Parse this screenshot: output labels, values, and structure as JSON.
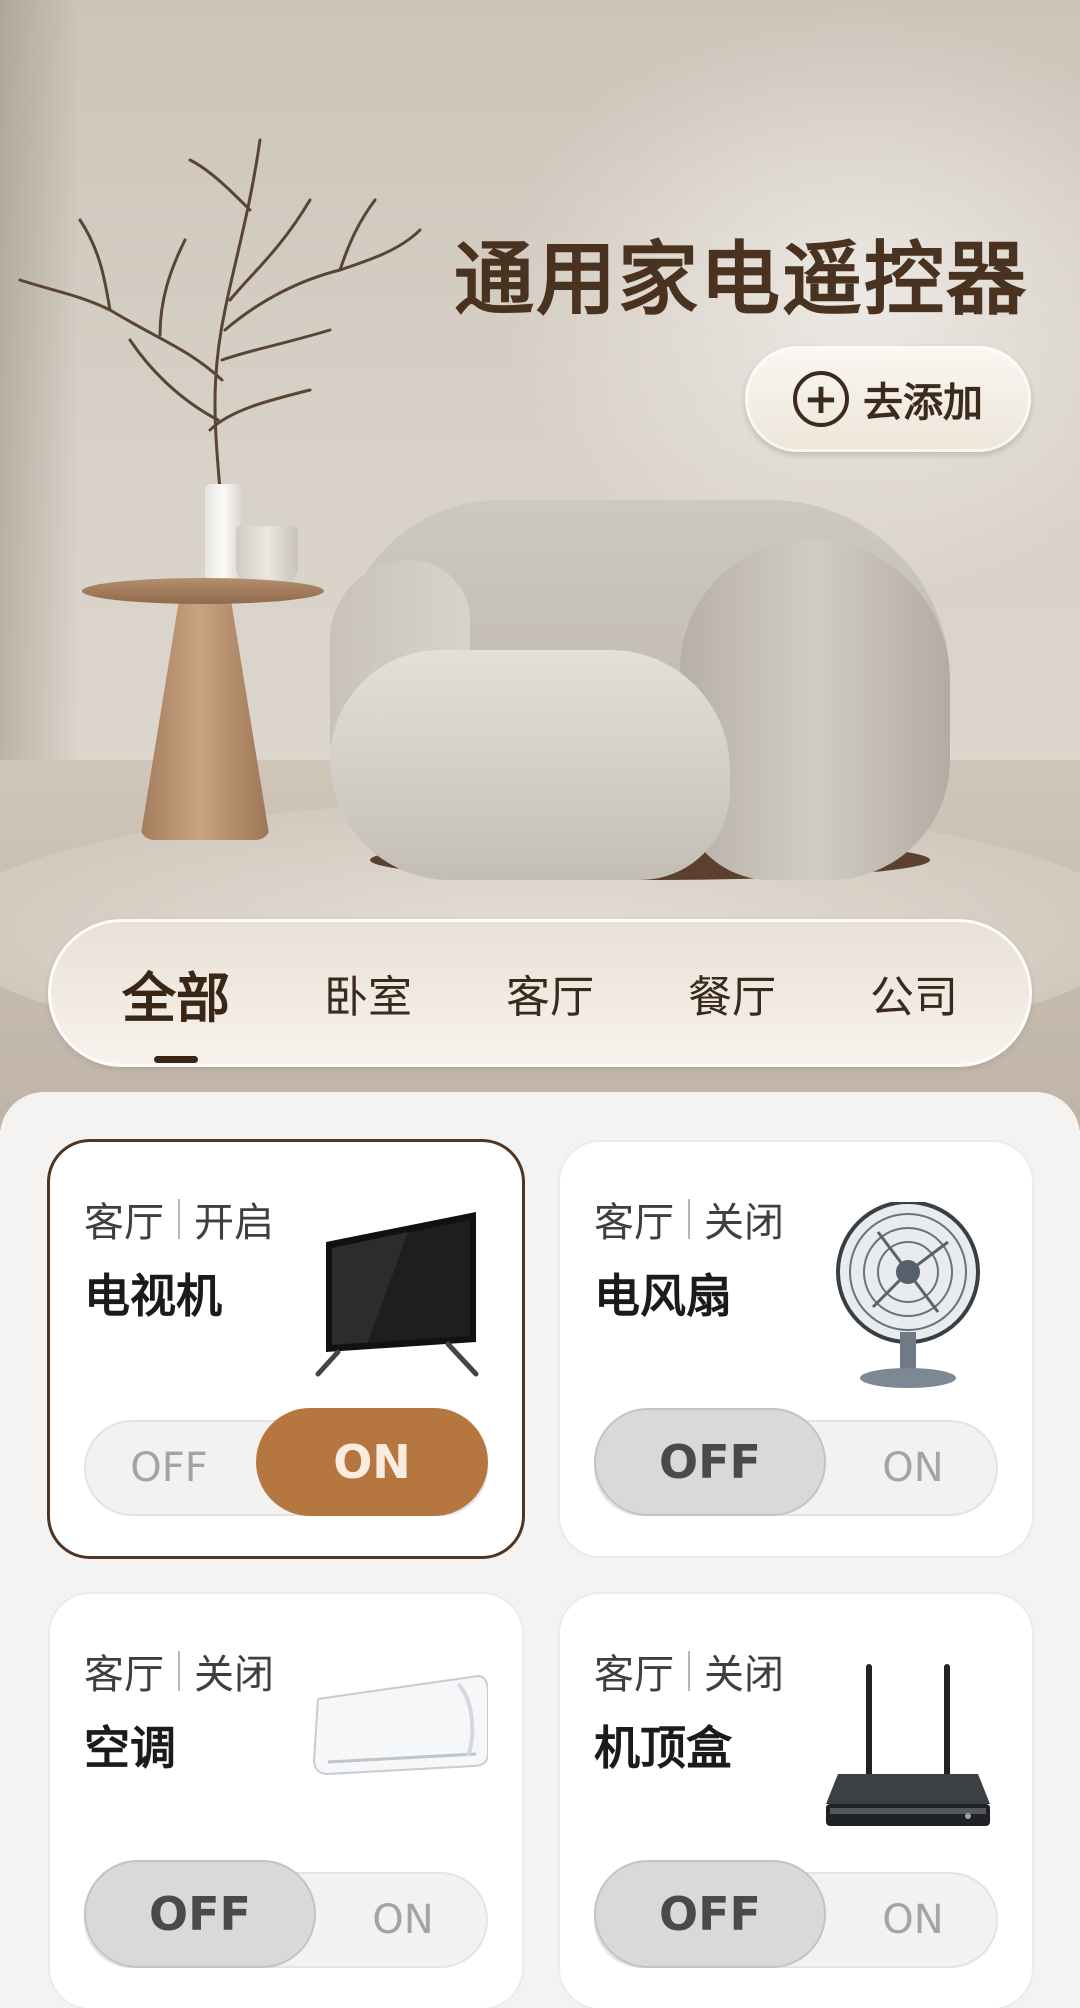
{
  "app": {
    "title": "通用家电遥控器",
    "add_button_label": "去添加",
    "add_icon_glyph": "+"
  },
  "tabs": [
    {
      "label": "全部",
      "active": true
    },
    {
      "label": "卧室",
      "active": false
    },
    {
      "label": "客厅",
      "active": false
    },
    {
      "label": "餐厅",
      "active": false
    },
    {
      "label": "公司",
      "active": false
    }
  ],
  "devices": [
    {
      "room": "客厅",
      "status": "开启",
      "name": "电视机",
      "icon": "tv-icon",
      "power": "ON",
      "off_label": "OFF",
      "on_label": "ON"
    },
    {
      "room": "客厅",
      "status": "关闭",
      "name": "电风扇",
      "icon": "fan-icon",
      "power": "OFF",
      "off_label": "OFF",
      "on_label": "ON"
    },
    {
      "room": "客厅",
      "status": "关闭",
      "name": "空调",
      "icon": "air-conditioner-icon",
      "power": "OFF",
      "off_label": "OFF",
      "on_label": "ON"
    },
    {
      "room": "客厅",
      "status": "关闭",
      "name": "机顶盒",
      "icon": "set-top-box-icon",
      "power": "OFF",
      "off_label": "OFF",
      "on_label": "ON"
    }
  ],
  "colors": {
    "title": "#4a3220",
    "accent_on": "#b5773f",
    "selected_border": "#4f3522"
  }
}
